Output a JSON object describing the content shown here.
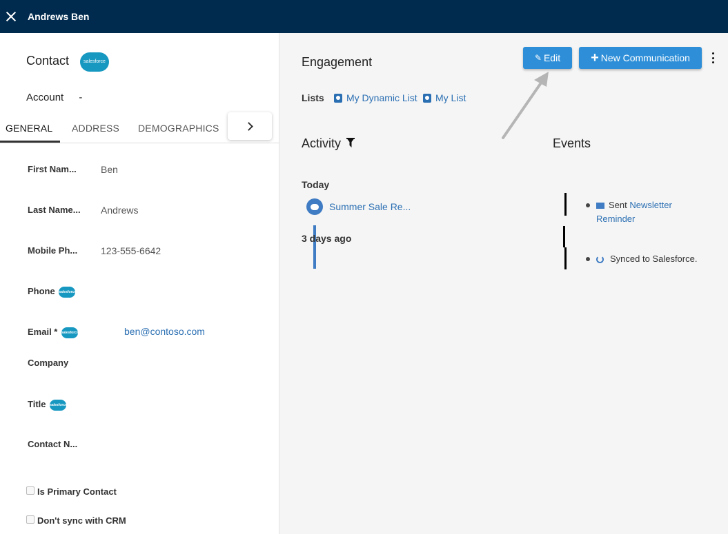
{
  "topbar": {
    "title": "Andrews Ben"
  },
  "contact": {
    "heading": "Contact",
    "sf_text": "salesforce",
    "account_label": "Account",
    "account_value": "-"
  },
  "tabs": [
    {
      "label": "GENERAL",
      "active": true
    },
    {
      "label": "ADDRESS",
      "active": false
    },
    {
      "label": "DEMOGRAPHICS",
      "active": false
    }
  ],
  "fields": {
    "first_name": {
      "label": "First Nam...",
      "value": "Ben"
    },
    "last_name": {
      "label": "Last Name...",
      "value": "Andrews"
    },
    "mobile": {
      "label": "Mobile Ph...",
      "value": "123-555-6642"
    },
    "phone": {
      "label": "Phone",
      "value": ""
    },
    "email": {
      "label": "Email *",
      "value": "ben@contoso.com"
    },
    "company": {
      "label": "Company",
      "value": ""
    },
    "title": {
      "label": "Title",
      "value": ""
    },
    "contact_note": {
      "label": "Contact N...",
      "value": ""
    }
  },
  "checkboxes": [
    {
      "label": "Is Primary Contact",
      "checked": false
    },
    {
      "label": "Don't sync with CRM",
      "checked": false
    }
  ],
  "engagement": {
    "title": "Engagement",
    "edit_label": "Edit",
    "new_comm_label": "New Communication",
    "lists_label": "Lists",
    "lists": [
      "My Dynamic List",
      "My List"
    ]
  },
  "activity": {
    "title": "Activity",
    "today_label": "Today",
    "today_item": "Summer Sale Re...",
    "older_label": "3 days ago"
  },
  "events": {
    "title": "Events",
    "sent_prefix": "Sent",
    "sent_link_line1": "Newsletter",
    "sent_link_line2": "Reminder",
    "synced_text": "Synced to Salesforce."
  },
  "colors": {
    "topbar": "#002b4e",
    "button": "#2e8fd8",
    "link": "#2b6fb3"
  }
}
